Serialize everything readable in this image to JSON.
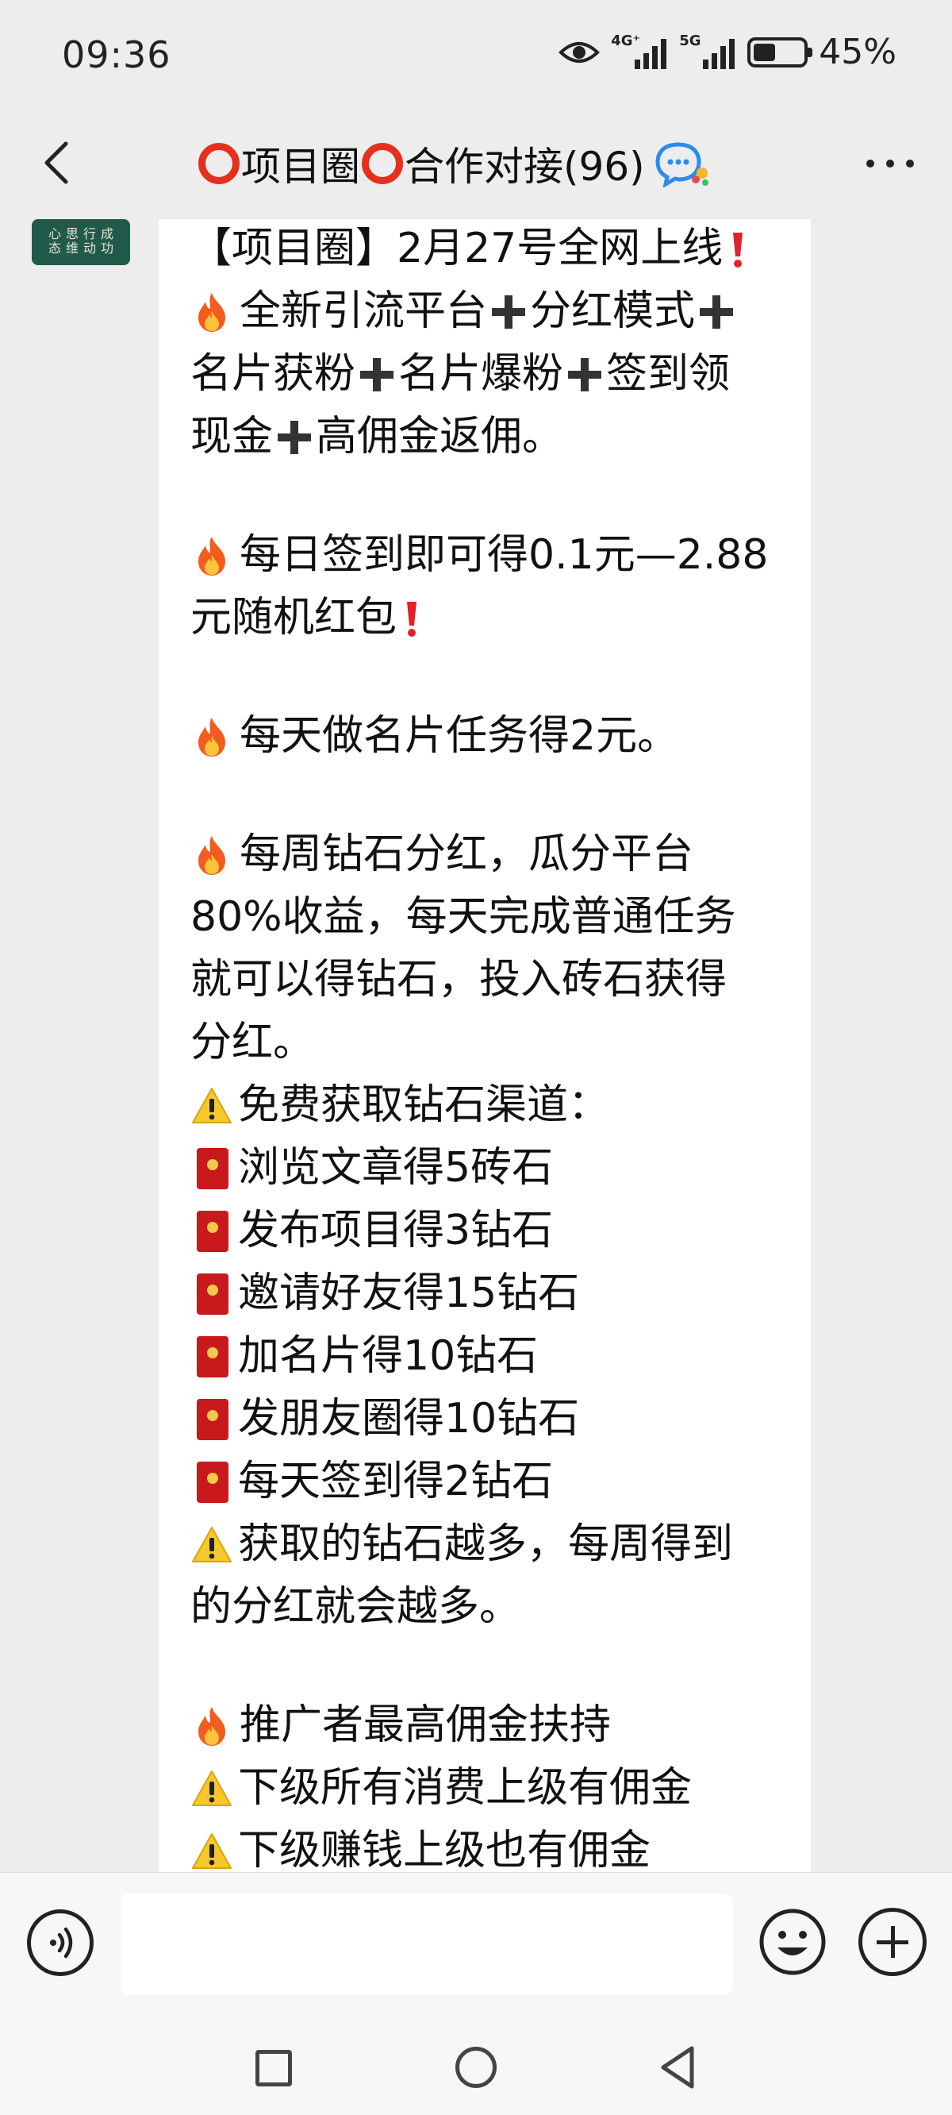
{
  "status_bar": {
    "time": "09:36",
    "network_4g": "4G⁺",
    "network_5g": "5G",
    "battery_percent_text": "45%",
    "battery_level": 0.45
  },
  "header": {
    "title": "项目圈",
    "title_mid": "合作对接(96)",
    "icons": [
      "back-arrow-icon",
      "red-ring-icon",
      "chat-bubble-icon",
      "more-dots-icon"
    ]
  },
  "avatar": {
    "text_columns": [
      "成功",
      "行动",
      "思维",
      "心态"
    ]
  },
  "message": {
    "lines": [
      {
        "prefix": "",
        "text": "【项目圈】2月27号全网上线",
        "suffix": "exclaim"
      },
      {
        "prefix": "fire",
        "parts": [
          "全新引流平台",
          "分红模式",
          ""
        ]
      },
      {
        "prefix": "",
        "parts": [
          "名片获粉",
          "名片爆粉",
          "签到领"
        ]
      },
      {
        "prefix": "",
        "parts": [
          "现金",
          "高佣金返佣。"
        ]
      },
      {
        "blank": true
      },
      {
        "prefix": "fire",
        "text": "每日签到即可得0.1元—2.88"
      },
      {
        "prefix": "",
        "text": "元随机红包",
        "suffix": "exclaim"
      },
      {
        "blank": true
      },
      {
        "prefix": "fire",
        "text": "每天做名片任务得2元。"
      },
      {
        "blank": true
      },
      {
        "prefix": "fire",
        "text": "每周钻石分红，瓜分平台"
      },
      {
        "prefix": "",
        "text": "80%收益，每天完成普通任务"
      },
      {
        "prefix": "",
        "text": "就可以得钻石，投入砖石获得"
      },
      {
        "prefix": "",
        "text": "分红。"
      },
      {
        "prefix": "warn",
        "text": "免费获取钻石渠道："
      },
      {
        "prefix": "envelope",
        "text": "浏览文章得5砖石"
      },
      {
        "prefix": "envelope",
        "text": "发布项目得3钻石"
      },
      {
        "prefix": "envelope",
        "text": "邀请好友得15钻石"
      },
      {
        "prefix": "envelope",
        "text": "加名片得10钻石"
      },
      {
        "prefix": "envelope",
        "text": "发朋友圈得10钻石"
      },
      {
        "prefix": "envelope",
        "text": "每天签到得2钻石"
      },
      {
        "prefix": "warn",
        "text": "获取的钻石越多，每周得到"
      },
      {
        "prefix": "",
        "text": "的分红就会越多。"
      },
      {
        "blank": true
      },
      {
        "prefix": "fire",
        "text": "推广者最高佣金扶持"
      },
      {
        "prefix": "warn",
        "text": "下级所有消费上级有佣金"
      },
      {
        "prefix": "warn",
        "text": "下级赚钱上级也有佣金"
      }
    ]
  },
  "input_bar": {
    "text_value": "",
    "icons": [
      "voice-icon",
      "emoji-icon",
      "add-icon"
    ]
  },
  "nav_bar": {
    "icons": [
      "recents-square-icon",
      "home-circle-icon",
      "back-triangle-icon"
    ]
  }
}
